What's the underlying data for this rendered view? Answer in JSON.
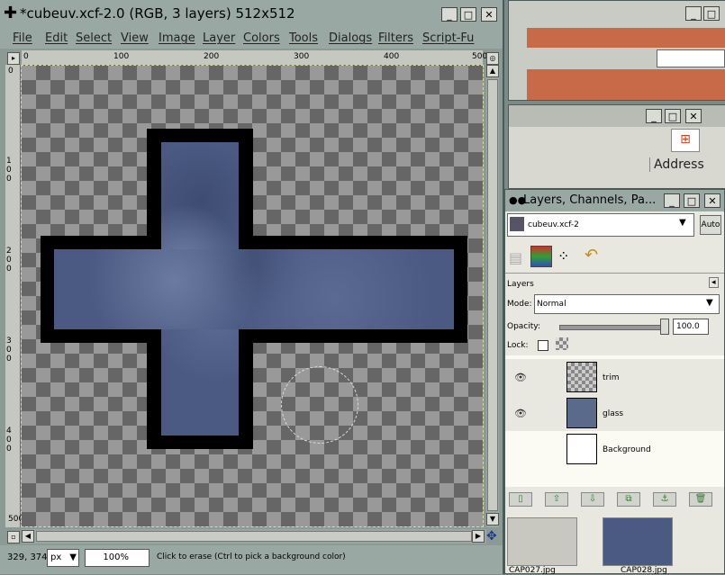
{
  "main_window": {
    "title": "*cubeuv.xcf-2.0 (RGB, 3 layers) 512x512",
    "menu": [
      "File",
      "Edit",
      "Select",
      "View",
      "Image",
      "Layer",
      "Colors",
      "Tools",
      "Dialogs",
      "Filters",
      "Script-Fu"
    ],
    "hruler_labels": [
      "0",
      "100",
      "200",
      "300",
      "400",
      "500"
    ],
    "vruler_labels": [
      "0",
      "100",
      "200",
      "300",
      "400",
      "500"
    ],
    "status": {
      "coords": "329, 374",
      "unit": "px",
      "zoom": "100%",
      "message": "Click to erase (Ctrl to pick a background color)"
    }
  },
  "browser_window": {
    "address_label": "Address"
  },
  "layers_dialog": {
    "title": "Layers, Channels, Pa...",
    "image_select": "cubeuv.xcf-2",
    "auto_label": "Auto",
    "section_label": "Layers",
    "mode_label": "Mode:",
    "mode_value": "Normal",
    "opacity_label": "Opacity:",
    "opacity_value": "100.0",
    "lock_label": "Lock:",
    "layers": [
      {
        "name": "trim",
        "visible": true
      },
      {
        "name": "glass",
        "visible": true
      },
      {
        "name": "Background",
        "visible": false
      }
    ]
  },
  "thumbnails": [
    "CAP027.jpg",
    "CAP028.jpg"
  ]
}
